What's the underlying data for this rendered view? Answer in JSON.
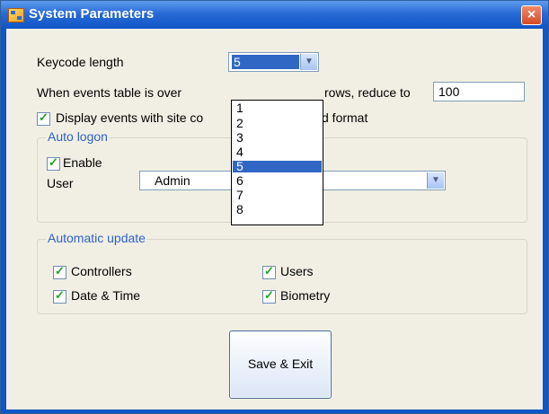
{
  "window": {
    "title": "System Parameters",
    "icon": "app-icon",
    "close_label": "×"
  },
  "keycode": {
    "label": "Keycode length",
    "value": "5",
    "options": [
      "1",
      "2",
      "3",
      "4",
      "5",
      "6",
      "7",
      "8"
    ],
    "selected": "5"
  },
  "events": {
    "prefix": "When events table is over",
    "suffix": "rows, reduce to",
    "reduce_value": "100"
  },
  "display_events": {
    "checked": true,
    "label_left": "Display events with site co",
    "label_right": "d format"
  },
  "auto_logon": {
    "legend": "Auto logon",
    "enable_label": "Enable",
    "enable_checked": true,
    "user_label": "User",
    "user_value": "Admin"
  },
  "automatic_update": {
    "legend": "Automatic update",
    "items": [
      {
        "label": "Controllers",
        "checked": true
      },
      {
        "label": "Users",
        "checked": true
      },
      {
        "label": "Date & Time",
        "checked": true
      },
      {
        "label": "Biometry",
        "checked": true
      }
    ]
  },
  "save_button": {
    "label": "Save & Exit"
  },
  "colors": {
    "title_bar": "#0f56c7",
    "selection": "#3167c4",
    "group_legend": "#2c62c8",
    "checkmark": "#21a121",
    "dialog_bg": "#f1efe3"
  }
}
